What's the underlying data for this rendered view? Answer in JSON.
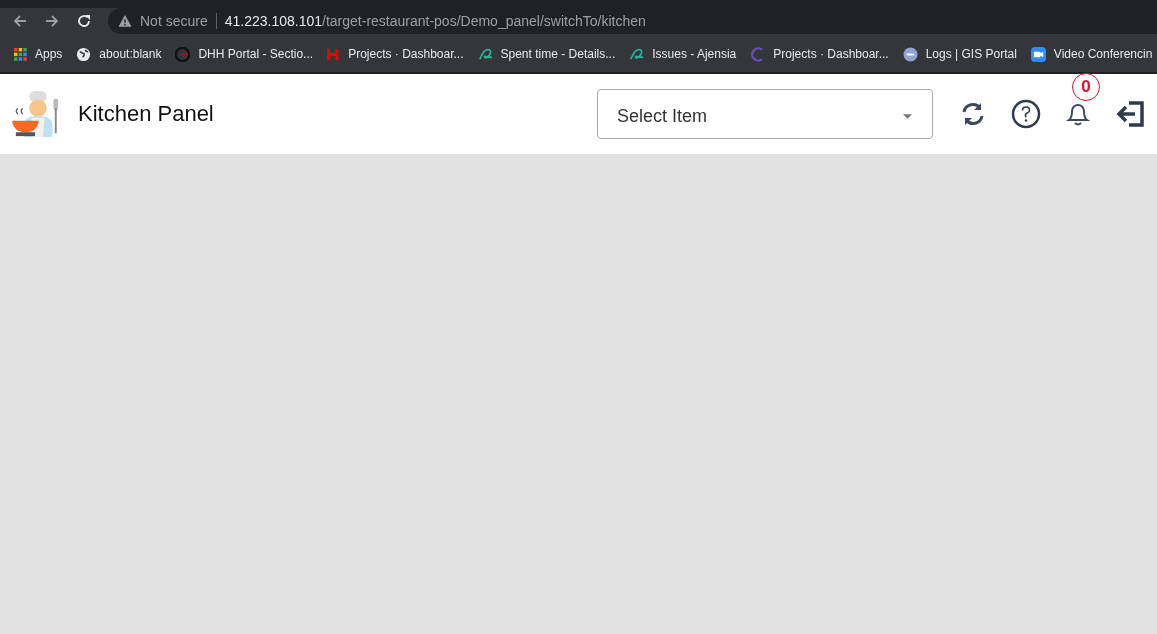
{
  "browser": {
    "security": "Not secure",
    "url_host": "41.223.108.101",
    "url_path": "/target-restaurant-pos/Demo_panel/switchTo/kitchen",
    "bookmarks": [
      {
        "label": "Apps"
      },
      {
        "label": "about:blank"
      },
      {
        "label": "DHH Portal - Sectio..."
      },
      {
        "label": "Projects · Dashboar..."
      },
      {
        "label": "Spent time - Details..."
      },
      {
        "label": "Issues - Ajensia"
      },
      {
        "label": "Projects · Dashboar..."
      },
      {
        "label": "Logs | GIS Portal"
      },
      {
        "label": "Video Conferencin"
      }
    ]
  },
  "header": {
    "title": "Kitchen Panel",
    "select": {
      "placeholder": "Select Item"
    },
    "notifications": "0"
  }
}
